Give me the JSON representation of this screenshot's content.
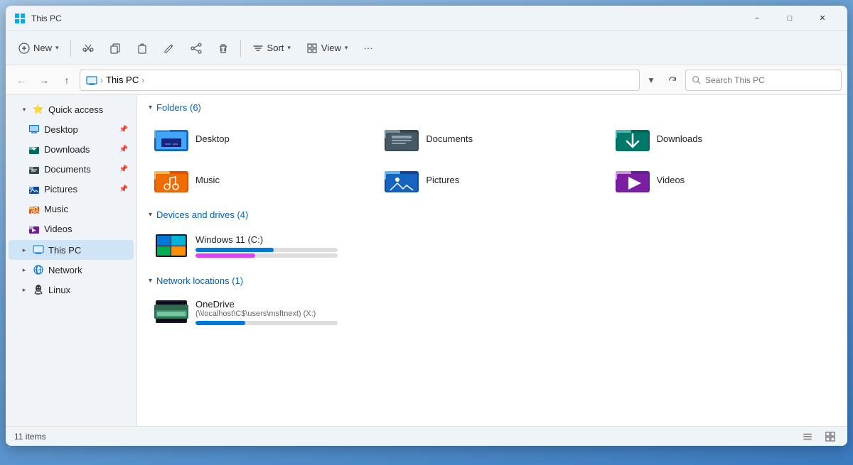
{
  "window": {
    "title": "This PC",
    "minimize_label": "−",
    "maximize_label": "□",
    "close_label": "✕"
  },
  "toolbar": {
    "new_label": "New",
    "cut_label": "",
    "copy_label": "",
    "paste_label": "",
    "rename_label": "",
    "share_label": "",
    "delete_label": "",
    "sort_label": "Sort",
    "view_label": "View",
    "more_label": "···"
  },
  "address_bar": {
    "path_icon": "this-pc-icon",
    "path_part1": "This PC",
    "path_part2": "",
    "search_placeholder": "Search This PC"
  },
  "sidebar": {
    "quick_access_label": "Quick access",
    "items": [
      {
        "label": "Desktop",
        "type": "desktop",
        "pinned": true
      },
      {
        "label": "Downloads",
        "type": "downloads",
        "pinned": true
      },
      {
        "label": "Documents",
        "type": "documents",
        "pinned": true
      },
      {
        "label": "Pictures",
        "type": "pictures",
        "pinned": true
      },
      {
        "label": "Music",
        "type": "music",
        "pinned": false
      },
      {
        "label": "Videos",
        "type": "videos",
        "pinned": false
      }
    ],
    "this_pc_label": "This PC",
    "network_label": "Network",
    "linux_label": "Linux"
  },
  "main": {
    "folders_section": "Folders (6)",
    "drives_section": "Devices and drives (4)",
    "network_section": "Network locations (1)",
    "folders": [
      {
        "name": "Desktop",
        "type": "desktop"
      },
      {
        "name": "Documents",
        "type": "documents"
      },
      {
        "name": "Downloads",
        "type": "downloads"
      },
      {
        "name": "Music",
        "type": "music"
      },
      {
        "name": "Pictures",
        "type": "pictures"
      },
      {
        "name": "Videos",
        "type": "videos"
      }
    ],
    "drives": [
      {
        "name": "Windows 11 (C:)",
        "type": "windows",
        "bar1_pct": 55,
        "bar2_pct": 42,
        "bar1_color": "blue",
        "bar2_color": "magenta"
      }
    ],
    "network_locations": [
      {
        "name": "OneDrive",
        "path": "(\\\\localhost\\C$\\users\\msftnext) (X:)",
        "bar_pct": 35
      }
    ]
  },
  "status_bar": {
    "items_count": "11 items"
  }
}
